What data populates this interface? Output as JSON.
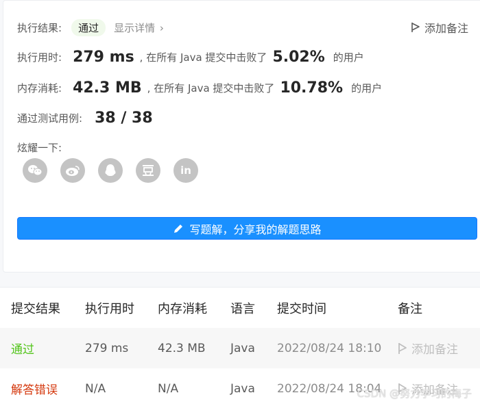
{
  "result_card": {
    "status_label": "执行结果:",
    "status_value": "通过",
    "details_link": "显示详情",
    "add_note_label": "添加备注",
    "runtime": {
      "label": "执行用时:",
      "value": "279 ms",
      "middle_text": ", 在所有 Java 提交中击败了",
      "percent": "5.02%",
      "suffix": "的用户"
    },
    "memory": {
      "label": "内存消耗:",
      "value": "42.3 MB",
      "middle_text": ", 在所有 Java 提交中击败了",
      "percent": "10.78%",
      "suffix": "的用户"
    },
    "tests": {
      "label": "通过测试用例:",
      "value": "38 / 38"
    },
    "share": {
      "label": "炫耀一下:",
      "icons": [
        "wechat-icon",
        "weibo-icon",
        "qq-icon",
        "douban-icon",
        "linkedin-icon"
      ]
    },
    "write_solution_button": "写题解，分享我的解题思路",
    "colors": {
      "accent": "#1a90ff",
      "pass_pill_bg": "#f0f9eb"
    }
  },
  "submissions": {
    "headers": {
      "result": "提交结果",
      "runtime": "执行用时",
      "memory": "内存消耗",
      "language": "语言",
      "time": "提交时间",
      "note": "备注"
    },
    "rows": [
      {
        "result": "通过",
        "runtime": "279 ms",
        "memory": "42.3 MB",
        "language": "Java",
        "time": "2022/08/24 18:10",
        "note": "添加备注"
      },
      {
        "result": "解答错误",
        "runtime": "N/A",
        "memory": "N/A",
        "language": "Java",
        "time": "2022/08/24 18:04",
        "note": "添加备注"
      }
    ],
    "colors": {
      "pass": "#52c41a",
      "error": "#d4380d"
    }
  },
  "watermark": "CSDN @努力学习的梅子"
}
